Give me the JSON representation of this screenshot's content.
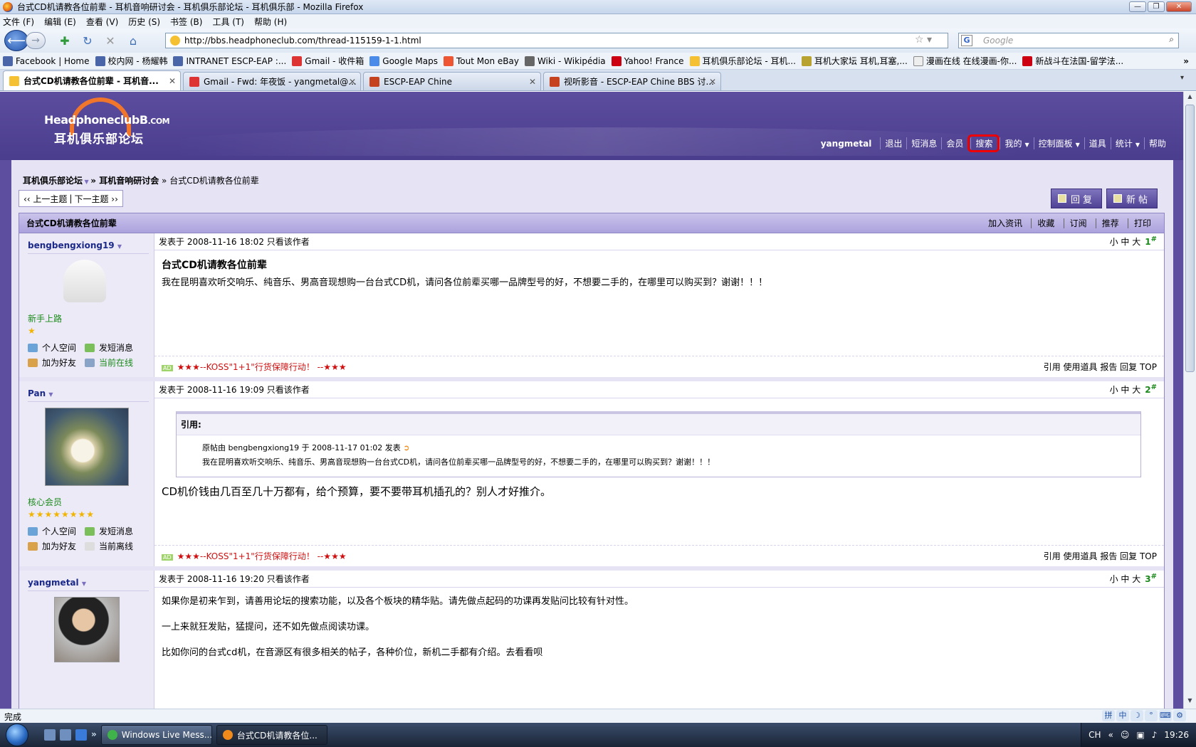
{
  "window": {
    "title": "台式CD机请教各位前辈 - 耳机音响研讨会 - 耳机俱乐部论坛 - 耳机俱乐部 - Mozilla Firefox"
  },
  "menu": [
    "文件 (F)",
    "编辑 (E)",
    "查看 (V)",
    "历史 (S)",
    "书签 (B)",
    "工具 (T)",
    "帮助 (H)"
  ],
  "nav": {
    "url": "http://bbs.headphoneclub.com/thread-115159-1-1.html",
    "search_placeholder": "Google"
  },
  "bookmarks": [
    "Facebook | Home",
    "校内网 - 杨耀韩",
    "INTRANET ESCP-EAP :...",
    "Gmail - 收件箱",
    "Google Maps",
    "Tout Mon eBay",
    "Wiki - Wikipédia",
    "Yahoo! France",
    "耳机俱乐部论坛 - 耳机...",
    "耳机大家坛 耳机,耳塞,...",
    "漫画在线 在线漫画-你...",
    "新战斗在法国-留学法..."
  ],
  "tabs": [
    "台式CD机请教各位前辈 - 耳机音...",
    "Gmail - Fwd: 年夜饭 - yangmetal@...",
    "ESCP-EAP Chine",
    "视听影音 - ESCP-EAP Chine BBS 讨..."
  ],
  "logo": {
    "en": "HeadphoneclubB",
    "com": ".COM",
    "cn": "耳机俱乐部论坛"
  },
  "topnav": {
    "user": "yangmetal",
    "items": [
      "退出",
      "短消息",
      "会员",
      "搜索",
      "我的",
      "控制面板",
      "道具",
      "统计",
      "帮助"
    ]
  },
  "breadcrumb": {
    "forum": "耳机俱乐部论坛",
    "sub": "» 耳机音响研讨会",
    "current": "» 台式CD机请教各位前辈"
  },
  "pager": {
    "prev": "‹‹ 上一主题",
    "next": "下一主题 ››"
  },
  "buttons": {
    "reply": "回复",
    "new": "新帖"
  },
  "thread": {
    "title": "台式CD机请教各位前辈",
    "links": [
      "加入资讯",
      "收藏",
      "订阅",
      "推荐",
      "打印"
    ]
  },
  "common": {
    "only_author": "只看该作者",
    "font_sizes": "小 中 大",
    "space": "个人空间",
    "msg": "发短消息",
    "friend": "加为好友",
    "ad": "★★★--KOSS\"1+1\"行货保障行动！ --★★★",
    "ad_badge": "AD",
    "foot_actions": "引用 使用道具 报告 回复 TOP"
  },
  "posts": [
    {
      "user": "bengbengxiong19",
      "time": "发表于 2008-11-16 18:02",
      "floor": "1",
      "rank": "新手上路",
      "stars": "★",
      "online": "当前在线",
      "title": "台式CD机请教各位前辈",
      "text": "我在昆明喜欢听交响乐、纯音乐、男高音现想购一台台式CD机，请问各位前辈买哪一品牌型号的好，不想要二手的，在哪里可以购买到？谢谢！！！"
    },
    {
      "user": "Pan",
      "time": "发表于 2008-11-16 19:09",
      "floor": "2",
      "rank": "核心会员",
      "stars": "★★★★★★★★",
      "online": "当前离线",
      "quote_head": "引用:",
      "quote_meta": "原帖由 bengbengxiong19 于 2008-11-17 01:02 发表",
      "quote_text": "我在昆明喜欢听交响乐、纯音乐、男高音现想购一台台式CD机，请问各位前辈买哪一品牌型号的好，不想要二手的，在哪里可以购买到？谢谢！！！",
      "text": "CD机价钱由几百至几十万都有，给个预算，要不要带耳机插孔的？别人才好推介。"
    },
    {
      "user": "yangmetal",
      "time": "发表于 2008-11-16 19:20",
      "floor": "3",
      "lines": [
        "如果你是初来乍到，请善用论坛的搜索功能，以及各个板块的精华贴。请先做点起码的功课再发贴问比较有针对性。",
        "一上来就狂发贴，猛提问，还不如先做点阅读功课。",
        "比如你问的台式cd机，在音源区有很多相关的帖子，各种价位，新机二手都有介绍。去看看呗"
      ]
    }
  ],
  "status": {
    "text": "完成"
  },
  "taskbar": {
    "tasks": [
      "Windows Live Mess...",
      "台式CD机请教各位..."
    ],
    "lang": "CH",
    "clock": "19:26"
  }
}
